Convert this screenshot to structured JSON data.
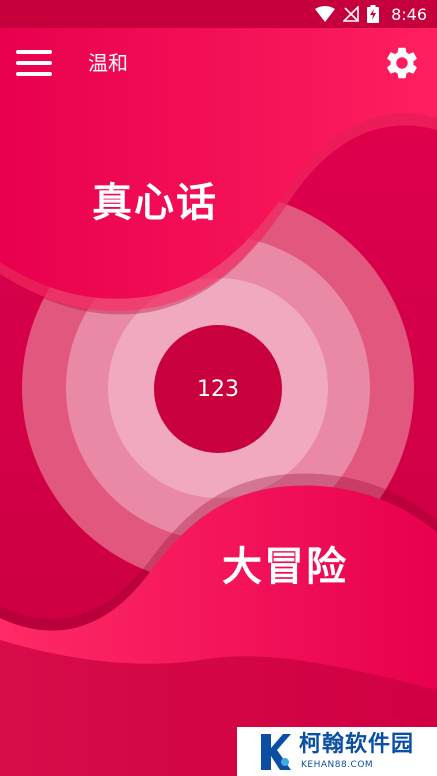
{
  "status_bar": {
    "time": "8:46",
    "icons": [
      "wifi-icon",
      "no-signal-icon",
      "battery-charging-icon"
    ]
  },
  "app_bar": {
    "title": "温和",
    "menu_icon": "hamburger-menu-icon",
    "settings_icon": "gear-icon"
  },
  "game": {
    "truth_label": "真心话",
    "dare_label": "大冒险",
    "center_value": "123"
  },
  "watermark": {
    "name": "柯翰软件园",
    "domain": "KEHAN88.COM"
  },
  "colors": {
    "background": "#d6004a",
    "status_bar": "#c5003c",
    "center_circle": "#c8003e",
    "ring_outer": "#e2577e",
    "ring_middle": "#ea89a6",
    "ring_inner": "#f0a9bf",
    "watermark_text": "#0a4fa3"
  }
}
